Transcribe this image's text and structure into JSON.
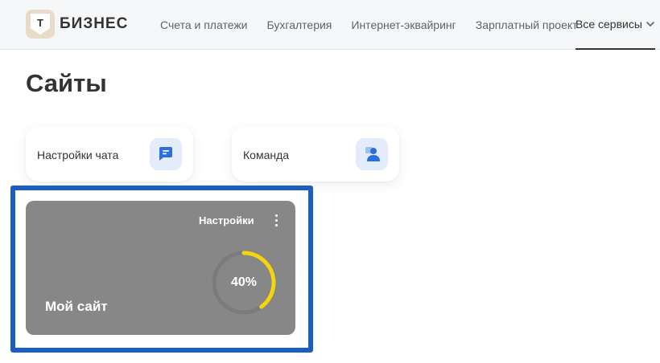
{
  "header": {
    "brand": "БИЗНЕС",
    "logo_letter": "Т",
    "nav": [
      {
        "label": "Счета и платежи"
      },
      {
        "label": "Бухгалтерия"
      },
      {
        "label": "Интернет-эквайринг"
      },
      {
        "label": "Зарплатный проект"
      }
    ],
    "all_services": "Все сервисы"
  },
  "page": {
    "title": "Сайты"
  },
  "tiles": [
    {
      "label": "Настройки чата",
      "icon": "chat-icon"
    },
    {
      "label": "Команда",
      "icon": "team-icon"
    }
  ],
  "site_card": {
    "settings_label": "Настройки",
    "name": "Мой сайт",
    "progress_text": "40%",
    "progress_fraction": 0.4,
    "progress_color": "#f5d50b",
    "track_color": "#7b7b7b"
  },
  "colors": {
    "accent_blue": "#1a5fc0",
    "icon_blue": "#2a6fdb",
    "icon_bg": "#e2ecfb"
  }
}
